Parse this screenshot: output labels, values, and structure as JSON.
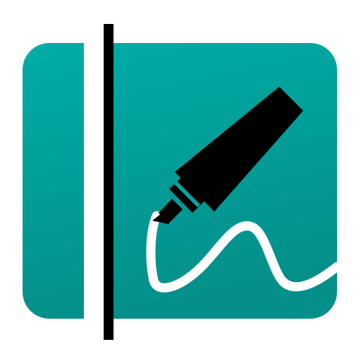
{
  "icon": {
    "name": "notebook-highlighter-app-icon",
    "colors": {
      "background": "#ffffff",
      "tile_top": "#00ada6",
      "tile_bottom": "#048f8a",
      "binding_stripe": "#ffffff",
      "spine": "#000000",
      "marker": "#000000",
      "marker_band": "#0aa39d",
      "stroke": "#ffffff"
    },
    "parts": [
      "notebook-icon",
      "binding-stripe",
      "notebook-spine",
      "highlighter-marker-icon",
      "handwriting-stroke"
    ]
  }
}
